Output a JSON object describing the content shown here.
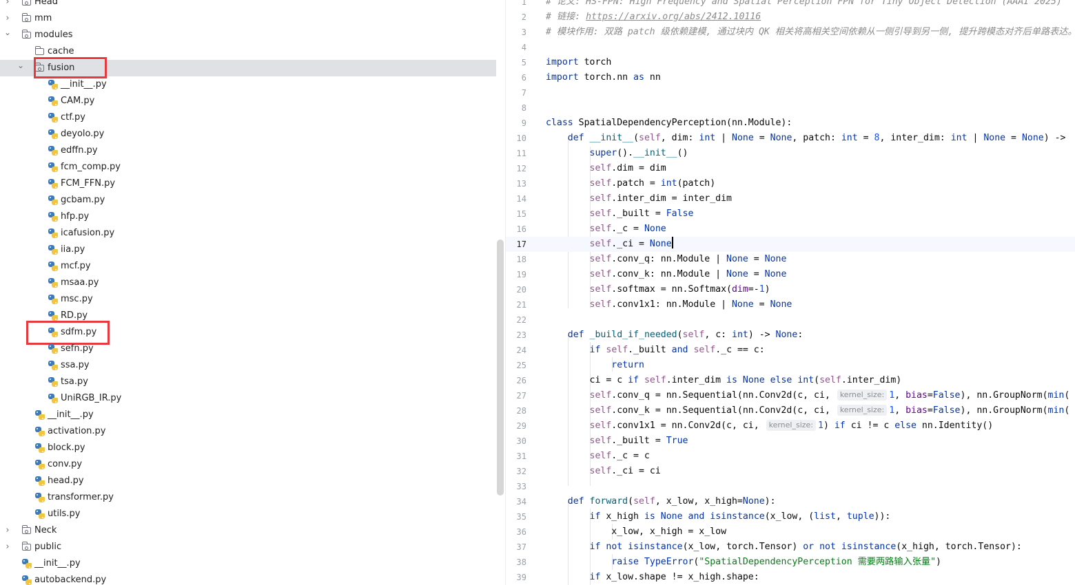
{
  "project_tree": {
    "rows": [
      {
        "label": "Head",
        "type": "folder",
        "depth": 0,
        "expanded": false
      },
      {
        "label": "mm",
        "type": "folder",
        "depth": 0,
        "expanded": false
      },
      {
        "label": "modules",
        "type": "folder",
        "depth": 0,
        "expanded": true
      },
      {
        "label": "cache",
        "type": "folder-plain",
        "depth": 1,
        "expanded": null
      },
      {
        "label": "fusion",
        "type": "folder",
        "depth": 1,
        "expanded": true,
        "selected": true,
        "highlight": true
      },
      {
        "label": "__init__.py",
        "type": "py",
        "depth": 2
      },
      {
        "label": "CAM.py",
        "type": "py",
        "depth": 2
      },
      {
        "label": "ctf.py",
        "type": "py",
        "depth": 2
      },
      {
        "label": "deyolo.py",
        "type": "py",
        "depth": 2
      },
      {
        "label": "edffn.py",
        "type": "py",
        "depth": 2
      },
      {
        "label": "fcm_comp.py",
        "type": "py",
        "depth": 2
      },
      {
        "label": "FCM_FFN.py",
        "type": "py",
        "depth": 2
      },
      {
        "label": "gcbam.py",
        "type": "py",
        "depth": 2
      },
      {
        "label": "hfp.py",
        "type": "py",
        "depth": 2
      },
      {
        "label": "icafusion.py",
        "type": "py",
        "depth": 2
      },
      {
        "label": "iia.py",
        "type": "py",
        "depth": 2
      },
      {
        "label": "mcf.py",
        "type": "py",
        "depth": 2
      },
      {
        "label": "msaa.py",
        "type": "py",
        "depth": 2
      },
      {
        "label": "msc.py",
        "type": "py",
        "depth": 2
      },
      {
        "label": "RD.py",
        "type": "py",
        "depth": 2
      },
      {
        "label": "sdfm.py",
        "type": "py",
        "depth": 2,
        "highlight": true
      },
      {
        "label": "sefn.py",
        "type": "py",
        "depth": 2
      },
      {
        "label": "ssa.py",
        "type": "py",
        "depth": 2
      },
      {
        "label": "tsa.py",
        "type": "py",
        "depth": 2
      },
      {
        "label": "UniRGB_IR.py",
        "type": "py",
        "depth": 2
      },
      {
        "label": "__init__.py",
        "type": "py",
        "depth": 1
      },
      {
        "label": "activation.py",
        "type": "py",
        "depth": 1
      },
      {
        "label": "block.py",
        "type": "py",
        "depth": 1
      },
      {
        "label": "conv.py",
        "type": "py",
        "depth": 1
      },
      {
        "label": "head.py",
        "type": "py",
        "depth": 1
      },
      {
        "label": "transformer.py",
        "type": "py",
        "depth": 1
      },
      {
        "label": "utils.py",
        "type": "py",
        "depth": 1
      },
      {
        "label": "Neck",
        "type": "folder",
        "depth": 0,
        "expanded": false
      },
      {
        "label": "public",
        "type": "folder",
        "depth": 0,
        "expanded": false
      },
      {
        "label": "__init__.py",
        "type": "py",
        "depth": 0
      },
      {
        "label": "autobackend.py",
        "type": "py",
        "depth": 0
      }
    ]
  },
  "editor": {
    "current_line": 17,
    "lines": [
      {
        "n": "1",
        "html": "<span class=\"c\"># 论文: HS-FPN: High Frequency and Spatial Perception FPN for Tiny Object Detection (AAAI 2025)</span>"
      },
      {
        "n": "2",
        "html": "<span class=\"c\"># 链接: </span><span class=\"u\">https://arxiv.org/abs/2412.10116</span>"
      },
      {
        "n": "3",
        "html": "<span class=\"c\"># 模块作用: 双路 patch 级依赖建模, 通过块内 QK 相关将高相关空间依赖从一侧引导到另一侧, 提升跨模态对齐后单路表达。</span>"
      },
      {
        "n": "4",
        "html": ""
      },
      {
        "n": "5",
        "html": "<span class=\"k\">import</span> torch"
      },
      {
        "n": "6",
        "html": "<span class=\"k\">import</span> torch.nn <span class=\"k\">as</span> nn"
      },
      {
        "n": "7",
        "html": ""
      },
      {
        "n": "8",
        "html": ""
      },
      {
        "n": "9",
        "html": "<span class=\"k\">class</span> SpatialDependencyPerception(nn.Module):"
      },
      {
        "n": "10",
        "html": "    <span class=\"k\">def</span> <span class=\"fn\">__init__</span>(<span class=\"s\">self</span>, dim: <span class=\"k\">int</span> | <span class=\"k\">None</span> = <span class=\"k\">None</span>, patch: <span class=\"k\">int</span> = <span class=\"n\">8</span>, inter_dim: <span class=\"k\">int</span> | <span class=\"k\">None</span> = <span class=\"k\">None</span>) -&gt;"
      },
      {
        "n": "11",
        "html": "        <span class=\"k\">super</span>().<span class=\"fn\">__init__</span>()"
      },
      {
        "n": "12",
        "html": "        <span class=\"s\">self</span>.dim = dim"
      },
      {
        "n": "13",
        "html": "        <span class=\"s\">self</span>.patch = <span class=\"k\">int</span>(patch)"
      },
      {
        "n": "14",
        "html": "        <span class=\"s\">self</span>.inter_dim = inter_dim"
      },
      {
        "n": "15",
        "html": "        <span class=\"s\">self</span>._built = <span class=\"k\">False</span>"
      },
      {
        "n": "16",
        "html": "        <span class=\"s\">self</span>._c = <span class=\"k\">None</span>"
      },
      {
        "n": "17",
        "html": "        <span class=\"s\">self</span>._ci = <span class=\"k\">None</span><span class=\"caret\"></span>"
      },
      {
        "n": "18",
        "html": "        <span class=\"s\">self</span>.conv_q: nn.Module | <span class=\"k\">None</span> = <span class=\"k\">None</span>"
      },
      {
        "n": "19",
        "html": "        <span class=\"s\">self</span>.conv_k: nn.Module | <span class=\"k\">None</span> = <span class=\"k\">None</span>"
      },
      {
        "n": "20",
        "html": "        <span class=\"s\">self</span>.softmax = nn.Softmax(<span class=\"kw\">dim</span>=-<span class=\"n\">1</span>)"
      },
      {
        "n": "21",
        "html": "        <span class=\"s\">self</span>.conv1x1: nn.Module | <span class=\"k\">None</span> = <span class=\"k\">None</span>"
      },
      {
        "n": "22",
        "html": ""
      },
      {
        "n": "23",
        "html": "    <span class=\"k\">def</span> <span class=\"fn\">_build_if_needed</span>(<span class=\"s\">self</span>, c: <span class=\"k\">int</span>) -&gt; <span class=\"k\">None</span>:"
      },
      {
        "n": "24",
        "html": "        <span class=\"k\">if</span> <span class=\"s\">self</span>._built <span class=\"k\">and</span> <span class=\"s\">self</span>._c == c:"
      },
      {
        "n": "25",
        "html": "            <span class=\"k\">return</span>"
      },
      {
        "n": "26",
        "html": "        ci = c <span class=\"k\">if</span> <span class=\"s\">self</span>.inter_dim <span class=\"k\">is</span> <span class=\"k\">None</span> <span class=\"k\">else</span> <span class=\"k\">int</span>(<span class=\"s\">self</span>.inter_dim)"
      },
      {
        "n": "27",
        "html": "        <span class=\"s\">self</span>.conv_q = nn.Sequential(nn.Conv2d(c, ci, <span class=\"hint\">kernel_size:</span><span class=\"n\">1</span>, <span class=\"kw\">bias</span>=<span class=\"k\">False</span>), nn.GroupNorm(<span class=\"k\">min</span>("
      },
      {
        "n": "28",
        "html": "        <span class=\"s\">self</span>.conv_k = nn.Sequential(nn.Conv2d(c, ci, <span class=\"hint\">kernel_size:</span><span class=\"n\">1</span>, <span class=\"kw\">bias</span>=<span class=\"k\">False</span>), nn.GroupNorm(<span class=\"k\">min</span>("
      },
      {
        "n": "29",
        "html": "        <span class=\"s\">self</span>.conv1x1 = nn.Conv2d(c, ci, <span class=\"hint\">kernel_size:</span><span class=\"n\">1</span>) <span class=\"k\">if</span> ci != c <span class=\"k\">else</span> nn.Identity()"
      },
      {
        "n": "30",
        "html": "        <span class=\"s\">self</span>._built = <span class=\"k\">True</span>"
      },
      {
        "n": "31",
        "html": "        <span class=\"s\">self</span>._c = c"
      },
      {
        "n": "32",
        "html": "        <span class=\"s\">self</span>._ci = ci"
      },
      {
        "n": "33",
        "html": ""
      },
      {
        "n": "34",
        "html": "    <span class=\"k\">def</span> <span class=\"fn\">forward</span>(<span class=\"s\">self</span>, x_low, x_high=<span class=\"k\">None</span>):"
      },
      {
        "n": "35",
        "html": "        <span class=\"k\">if</span> x_high <span class=\"k\">is</span> <span class=\"k\">None</span> <span class=\"k\">and</span> <span class=\"k\">isinstance</span>(x_low, (<span class=\"k\">list</span>, <span class=\"k\">tuple</span>)):"
      },
      {
        "n": "36",
        "html": "            x_low, x_high = x_low"
      },
      {
        "n": "37",
        "html": "        <span class=\"k\">if</span> <span class=\"k\">not</span> <span class=\"k\">isinstance</span>(x_low, torch.Tensor) <span class=\"k\">or</span> <span class=\"k\">not</span> <span class=\"k\">isinstance</span>(x_high, torch.Tensor):"
      },
      {
        "n": "38",
        "html": "            <span class=\"k\">raise</span> <span class=\"k\">TypeError</span>(<span class=\"str\">\"SpatialDependencyPerception 需要两路输入张量\"</span>)"
      },
      {
        "n": "39",
        "html": "        <span class=\"k\">if</span> x_low.shape != x_high.shape:"
      }
    ]
  }
}
